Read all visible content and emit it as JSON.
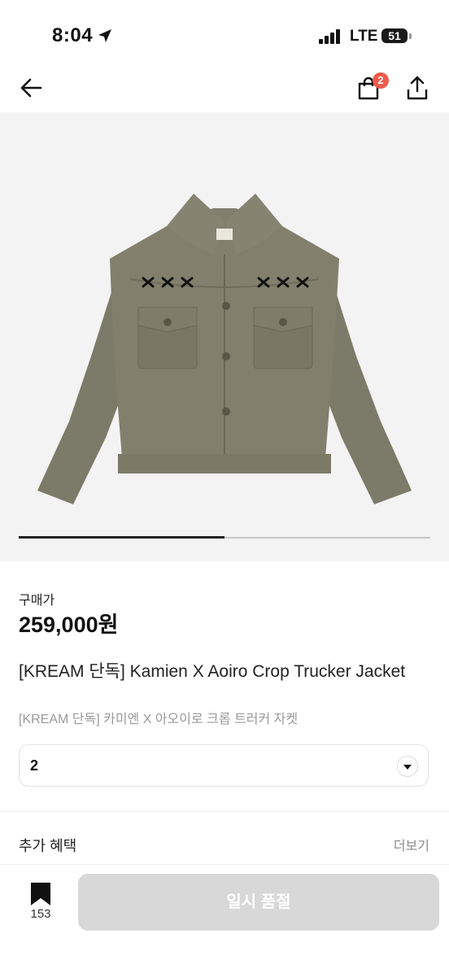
{
  "status_bar": {
    "time": "8:04",
    "network": "LTE",
    "battery": "51"
  },
  "nav": {
    "back_icon": "arrow-left-icon",
    "cart_icon": "shopping-bag-icon",
    "cart_badge": "2",
    "share_icon": "share-icon",
    "badge_color": "#ef5a4c"
  },
  "gallery": {
    "image_subject": "olive trucker jacket with embroidered x marks",
    "current_page_fraction": 0.5
  },
  "product": {
    "price_label": "구매가",
    "price": "259,000원",
    "title": "[KREAM 단독] Kamien X Aoiro Crop Trucker Jacket",
    "subtitle": "[KREAM 단독] 카미엔 X 아오이로 크롭 트러커 자켓"
  },
  "size_select": {
    "value": "2",
    "icon": "chevron-down-icon"
  },
  "benefits": {
    "label": "추가 혜택",
    "more": "더보기"
  },
  "bottom_bar": {
    "bookmark_icon": "bookmark-icon",
    "bookmark_count": "153",
    "action_label": "일시 품절"
  }
}
